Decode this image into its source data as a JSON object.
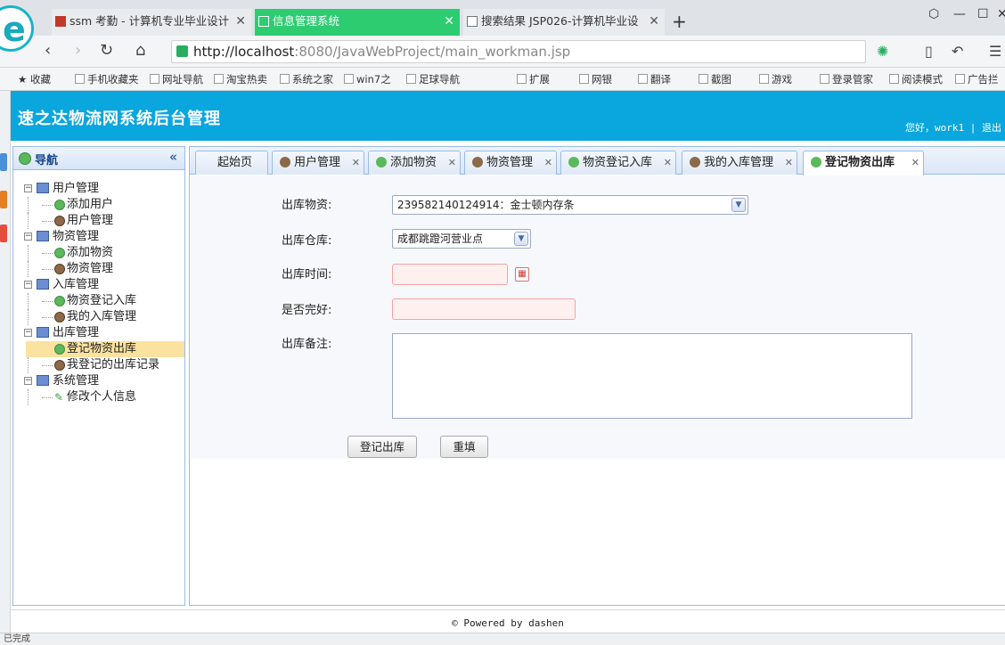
{
  "browser": {
    "tabs": [
      {
        "label": "ssm 考勤 - 计算机专业毕业设计"
      },
      {
        "label": "信息管理系统"
      },
      {
        "label": "搜索结果 JSP026-计算机毕业设"
      }
    ],
    "url_host": "http://localhost",
    "url_rest": ":8080/JavaWebProject/main_workman.jsp",
    "bookmarks": [
      "收藏",
      "手机收藏夹",
      "网址导航",
      "淘宝热卖",
      "系统之家",
      "win7之",
      "足球导航",
      "扩展",
      "网银",
      "翻译",
      "截图",
      "游戏",
      "登录管家",
      "阅读模式",
      "广告拦"
    ],
    "status": "已完成"
  },
  "app": {
    "title": "速之达物流网系统后台管理",
    "user_greeting": "您好，work1",
    "logout": "退出"
  },
  "nav": {
    "title": "导航",
    "collapse": "«",
    "groups": [
      {
        "label": "用户管理",
        "items": [
          {
            "label": "添加用户",
            "icon": "add"
          },
          {
            "label": "用户管理",
            "icon": "user"
          }
        ]
      },
      {
        "label": "物资管理",
        "items": [
          {
            "label": "添加物资",
            "icon": "add"
          },
          {
            "label": "物资管理",
            "icon": "user"
          }
        ]
      },
      {
        "label": "入库管理",
        "items": [
          {
            "label": "物资登记入库",
            "icon": "add"
          },
          {
            "label": "我的入库管理",
            "icon": "user"
          }
        ]
      },
      {
        "label": "出库管理",
        "items": [
          {
            "label": "登记物资出库",
            "icon": "add"
          },
          {
            "label": "我登记的出库记录",
            "icon": "user"
          }
        ]
      },
      {
        "label": "系统管理",
        "items": [
          {
            "label": "修改个人信息",
            "icon": "edit"
          }
        ]
      }
    ]
  },
  "content_tabs": [
    {
      "label": "起始页"
    },
    {
      "label": "用户管理"
    },
    {
      "label": "添加物资"
    },
    {
      "label": "物资管理"
    },
    {
      "label": "物资登记入库"
    },
    {
      "label": "我的入库管理"
    },
    {
      "label": "登记物资出库"
    }
  ],
  "form": {
    "material_label": "出库物资:",
    "material_value": "239582140124914：金士顿内存条",
    "warehouse_label": "出库仓库:",
    "warehouse_value": "成都跳蹬河营业点",
    "time_label": "出库时间:",
    "time_value": "",
    "condition_label": "是否完好:",
    "condition_value": "",
    "note_label": "出库备注:",
    "note_value": "",
    "submit_label": "登记出库",
    "reset_label": "重填"
  },
  "footer": "© Powered by dashen",
  "colors": {
    "header": "#0aa6de",
    "active_tab": "#2ecc71",
    "panel_border": "#99bbe8"
  }
}
